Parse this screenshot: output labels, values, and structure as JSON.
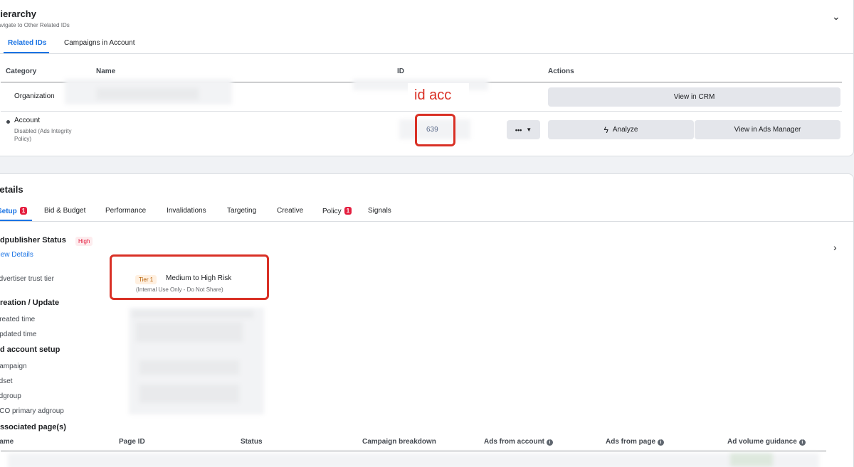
{
  "hierarchy": {
    "title": "Hierarchy",
    "subtitle": "Navigate to Other Related IDs",
    "tabs": [
      {
        "label": "Related IDs"
      },
      {
        "label": "Campaigns in Account"
      }
    ],
    "columns": [
      "Category",
      "Name",
      "ID",
      "Actions"
    ],
    "rows": [
      {
        "category": "Organization",
        "action": "View in CRM"
      },
      {
        "category": "Account",
        "sub": "Disabled (Ads Integrity Policy)",
        "id": "639",
        "more_label": "•••",
        "analyze": "Analyze",
        "view_ads": "View in Ads Manager"
      }
    ],
    "annotation": "id acc"
  },
  "details": {
    "title": "Details",
    "tabs": [
      {
        "label": "Setup",
        "badge": "1"
      },
      {
        "label": "Bid & Budget"
      },
      {
        "label": "Performance"
      },
      {
        "label": "Invalidations"
      },
      {
        "label": "Targeting"
      },
      {
        "label": "Creative"
      },
      {
        "label": "Policy",
        "badge": "1"
      },
      {
        "label": "Signals"
      }
    ],
    "publisher_status": {
      "label": "Adpublisher Status",
      "badge": "High",
      "link": "View Details"
    },
    "trust_tier": {
      "label": "Advertiser trust tier",
      "tier": "Tier 1",
      "value": "Medium to High Risk",
      "note": "(Internal Use Only - Do Not Share)"
    },
    "creation": {
      "title": "Creation / Update",
      "created": "Created time",
      "updated": "Updated time"
    },
    "setup": {
      "title": "Ad account setup",
      "campaign": "Campaign",
      "adset": "Adset",
      "adgroup": "Adgroup",
      "primary": "DCO primary adgroup"
    },
    "associated": "Associated page(s)",
    "page_columns": [
      "Name",
      "Page ID",
      "Status",
      "Campaign breakdown",
      "Ads from account",
      "Ads from page",
      "Ad volume guidance"
    ]
  }
}
